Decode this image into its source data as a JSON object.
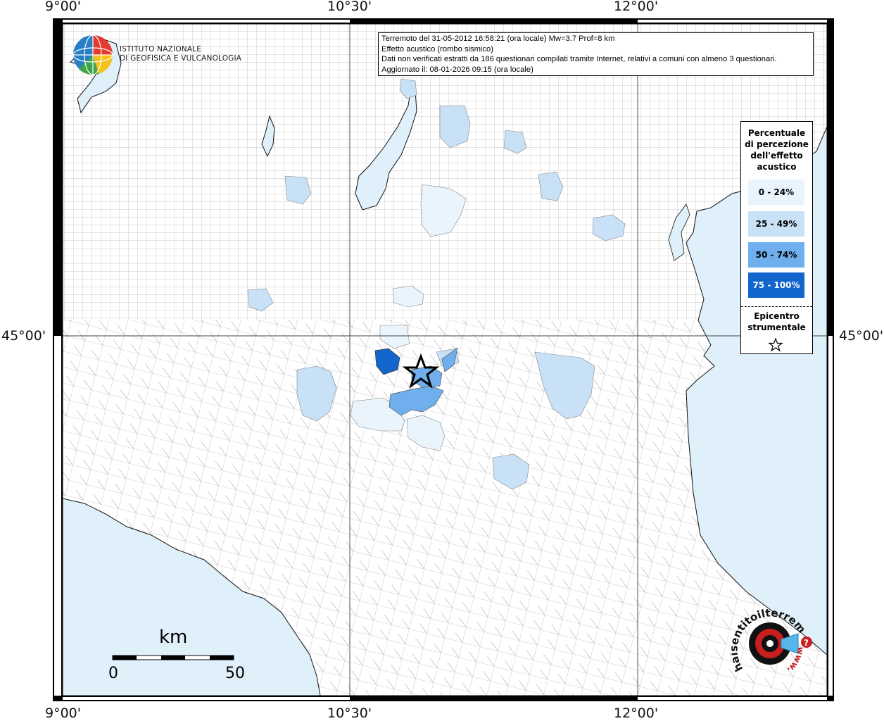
{
  "map": {
    "lon_labels": [
      "9°00'",
      "10°30'",
      "12°00'"
    ],
    "lat_labels": [
      "45°00'"
    ],
    "colors": {
      "land": "#ffffff",
      "sea": "#dff0fb",
      "border": "#808080",
      "class_0_24": "#eaf4fc",
      "class_25_49": "#c8e1f7",
      "class_50_74": "#6fafee",
      "class_75_100": "#1266cc"
    }
  },
  "info": {
    "line1": "Terremoto del 31-05-2012 16:58:21 (ora locale) Mw=3.7 Prof=8 km",
    "line2": "Effetto acustico (rombo sismico)",
    "line3": "Dati non verificati estratti da 186 questionari compilati tramite Internet, relativi a comuni con almeno 3 questionari.",
    "line4": "Aggiornato il: 08-01-2026 09:15 (ora locale)"
  },
  "legend": {
    "title": "Percentuale di percezione dell'effetto acustico",
    "classes": [
      "0 - 24%",
      "25 - 49%",
      "50 - 74%",
      "75 - 100%"
    ],
    "epicenter_label": "Epicentro strumentale"
  },
  "logo": {
    "org_line1": "ISTITUTO NAZIONALE",
    "org_line2": "DI GEOFISICA E VULCANOLOGIA"
  },
  "scale_bar": {
    "unit": "km",
    "start": "0",
    "end": "50"
  },
  "hai_sentito": {
    "text": "haisentitoilterremoto.it",
    "www": "www.",
    "mark": "?"
  }
}
